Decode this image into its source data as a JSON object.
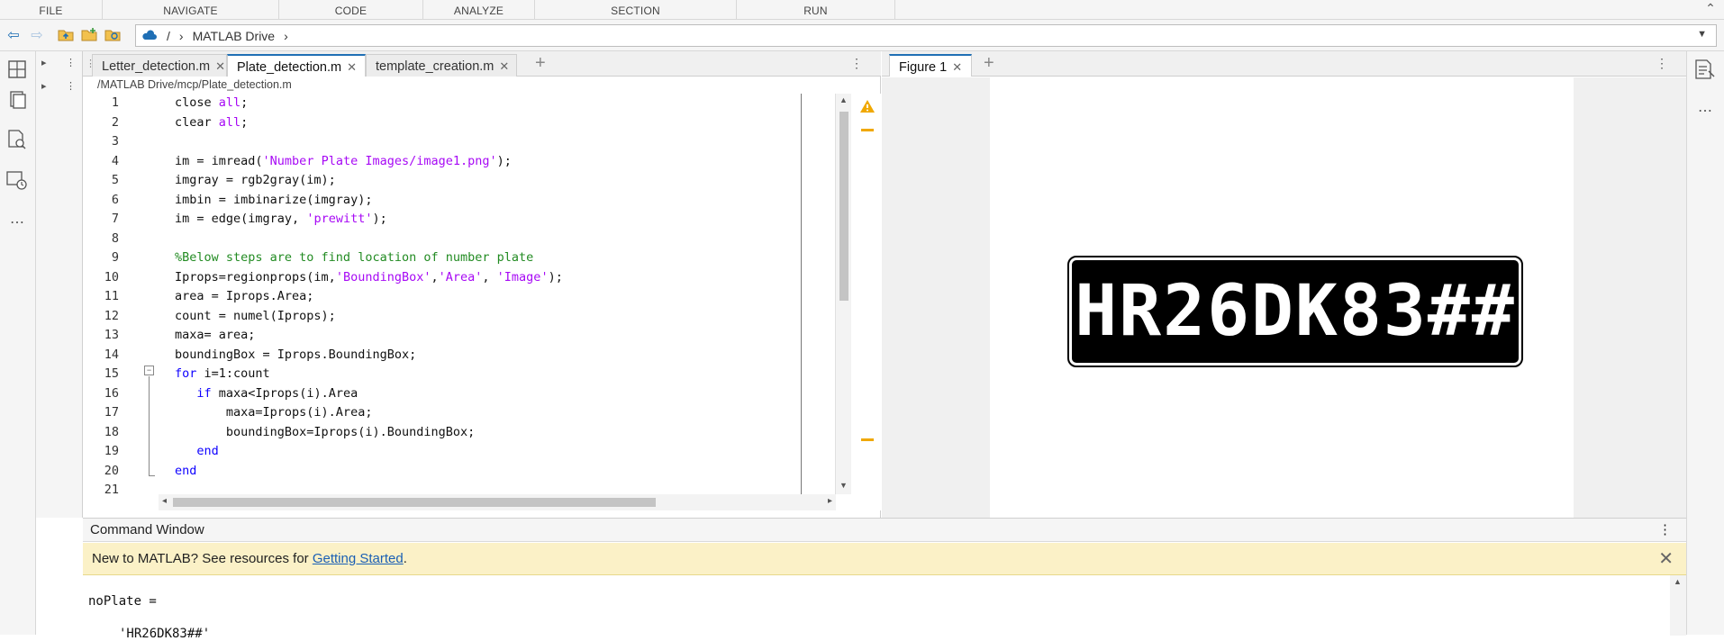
{
  "toolstrip": {
    "tabs": [
      "FILE",
      "NAVIGATE",
      "CODE",
      "ANALYZE",
      "SECTION",
      "RUN"
    ]
  },
  "address": {
    "sep": "/",
    "crumb": "MATLAB Drive",
    "chevron": "›"
  },
  "editor": {
    "tabs": [
      {
        "label": "Letter_detection.m"
      },
      {
        "label": "Plate_detection.m"
      },
      {
        "label": "template_creation.m"
      }
    ],
    "active_tab": "Plate_detection.m",
    "path": "/MATLAB Drive/mcp/Plate_detection.m",
    "line_numbers": [
      "1",
      "2",
      "3",
      "4",
      "5",
      "6",
      "7",
      "8",
      "9",
      "10",
      "11",
      "12",
      "13",
      "14",
      "15",
      "16",
      "17",
      "18",
      "19",
      "20",
      "21"
    ]
  },
  "figure": {
    "tab_label": "Figure 1",
    "plate_text": "HR26DK83##"
  },
  "command_window": {
    "title": "Command Window",
    "banner_text": "New to MATLAB? See resources for ",
    "banner_link": "Getting Started",
    "banner_end": ".",
    "output_var": "noPlate =",
    "output_val": "'HR26DK83##'"
  }
}
